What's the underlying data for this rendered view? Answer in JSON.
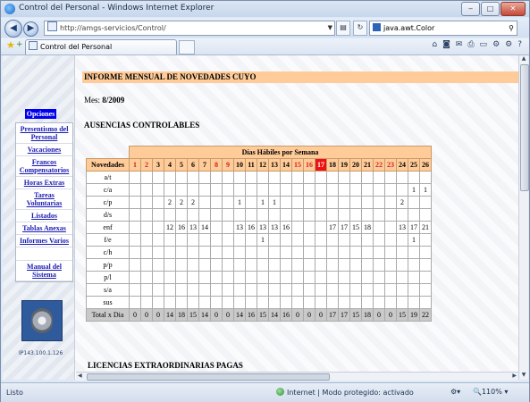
{
  "window": {
    "title": "Control del Personal - Windows Internet Explorer"
  },
  "addressbar": {
    "url": "http://amgs-servicios/Control/",
    "search_text": "java.awt.Color"
  },
  "tabs": [
    {
      "label": "Control del Personal"
    }
  ],
  "sidebar": {
    "header": "Opciones",
    "items": [
      {
        "label": "Presentismo del Personal"
      },
      {
        "label": "Vacaciones"
      },
      {
        "label": "Francos Compensatorios"
      },
      {
        "label": "Horas Extras"
      },
      {
        "label": "Tareas Voluntarias"
      },
      {
        "label": "Listados"
      },
      {
        "label": "Tablas Anexas"
      },
      {
        "label": "Informes Varios"
      },
      {
        "label": ""
      },
      {
        "label": "Manual del Sistema"
      }
    ],
    "ip": "IP143.100.1.126"
  },
  "report": {
    "title": "INFORME MENSUAL DE NOVEDADES CUYO",
    "mes_label": "Mes:",
    "mes_value": "8/2009",
    "section1": "AUSENCIAS CONTROLABLES",
    "dias_header": "Días Hábiles por Semana",
    "novedades_header": "Novedades",
    "days": [
      "1",
      "2",
      "3",
      "4",
      "5",
      "6",
      "7",
      "8",
      "9",
      "10",
      "11",
      "12",
      "13",
      "14",
      "15",
      "16",
      "17",
      "18",
      "19",
      "20",
      "21",
      "22",
      "23",
      "24",
      "25",
      "26"
    ],
    "weekend_days": [
      "1",
      "2",
      "8",
      "9",
      "15",
      "16",
      "22",
      "23"
    ],
    "today": "17",
    "rows": [
      {
        "label": "a/t",
        "cells": [
          "",
          "",
          "",
          "",
          "",
          "",
          "",
          "",
          "",
          "",
          "",
          "",
          "",
          "",
          "",
          "",
          "",
          "",
          "",
          "",
          "",
          "",
          "",
          "",
          "",
          ""
        ]
      },
      {
        "label": "c/a",
        "cells": [
          "",
          "",
          "",
          "",
          "",
          "",
          "",
          "",
          "",
          "",
          "",
          "",
          "",
          "",
          "",
          "",
          "",
          "",
          "",
          "",
          "",
          "",
          "",
          "",
          "1",
          "1"
        ]
      },
      {
        "label": "c/p",
        "cells": [
          "",
          "",
          "",
          "2",
          "2",
          "2",
          "",
          "",
          "",
          "1",
          "",
          "1",
          "1",
          "",
          "",
          "",
          "",
          "",
          "",
          "",
          "",
          "",
          "",
          "2",
          "",
          ""
        ]
      },
      {
        "label": "d/s",
        "cells": [
          "",
          "",
          "",
          "",
          "",
          "",
          "",
          "",
          "",
          "",
          "",
          "",
          "",
          "",
          "",
          "",
          "",
          "",
          "",
          "",
          "",
          "",
          "",
          "",
          "",
          ""
        ]
      },
      {
        "label": "enf",
        "cells": [
          "",
          "",
          "",
          "12",
          "16",
          "13",
          "14",
          "",
          "",
          "13",
          "16",
          "13",
          "13",
          "16",
          "",
          "",
          "",
          "17",
          "17",
          "15",
          "18",
          "",
          "",
          "13",
          "17",
          "21"
        ]
      },
      {
        "label": "f/e",
        "cells": [
          "",
          "",
          "",
          "",
          "",
          "",
          "",
          "",
          "",
          "",
          "",
          "1",
          "",
          "",
          "",
          "",
          "",
          "",
          "",
          "",
          "",
          "",
          "",
          "",
          "1",
          ""
        ]
      },
      {
        "label": "c/h",
        "cells": [
          "",
          "",
          "",
          "",
          "",
          "",
          "",
          "",
          "",
          "",
          "",
          "",
          "",
          "",
          "",
          "",
          "",
          "",
          "",
          "",
          "",
          "",
          "",
          "",
          "",
          ""
        ]
      },
      {
        "label": "p/p",
        "cells": [
          "",
          "",
          "",
          "",
          "",
          "",
          "",
          "",
          "",
          "",
          "",
          "",
          "",
          "",
          "",
          "",
          "",
          "",
          "",
          "",
          "",
          "",
          "",
          "",
          "",
          ""
        ]
      },
      {
        "label": "p/l",
        "cells": [
          "",
          "",
          "",
          "",
          "",
          "",
          "",
          "",
          "",
          "",
          "",
          "",
          "",
          "",
          "",
          "",
          "",
          "",
          "",
          "",
          "",
          "",
          "",
          "",
          "",
          ""
        ]
      },
      {
        "label": "s/a",
        "cells": [
          "",
          "",
          "",
          "",
          "",
          "",
          "",
          "",
          "",
          "",
          "",
          "",
          "",
          "",
          "",
          "",
          "",
          "",
          "",
          "",
          "",
          "",
          "",
          "",
          "",
          ""
        ]
      },
      {
        "label": "sus",
        "cells": [
          "",
          "",
          "",
          "",
          "",
          "",
          "",
          "",
          "",
          "",
          "",
          "",
          "",
          "",
          "",
          "",
          "",
          "",
          "",
          "",
          "",
          "",
          "",
          "",
          "",
          ""
        ]
      }
    ],
    "total_label": "Total x Dia",
    "totals": [
      "0",
      "0",
      "0",
      "14",
      "18",
      "15",
      "14",
      "0",
      "0",
      "14",
      "16",
      "15",
      "14",
      "16",
      "0",
      "0",
      "0",
      "17",
      "17",
      "15",
      "18",
      "0",
      "0",
      "15",
      "19",
      "22"
    ],
    "section2": "LICENCIAS EXTRAORDINARIAS PAGAS"
  },
  "statusbar": {
    "left": "Listo",
    "zone": "Internet | Modo protegido: activado",
    "zoom": "110%"
  },
  "colors": {
    "report_band": "#ffcc99",
    "today": "#ee1111",
    "weekend": "#d42020",
    "total_row": "#c9c9c9",
    "sidebar_header": "#0000ee"
  }
}
